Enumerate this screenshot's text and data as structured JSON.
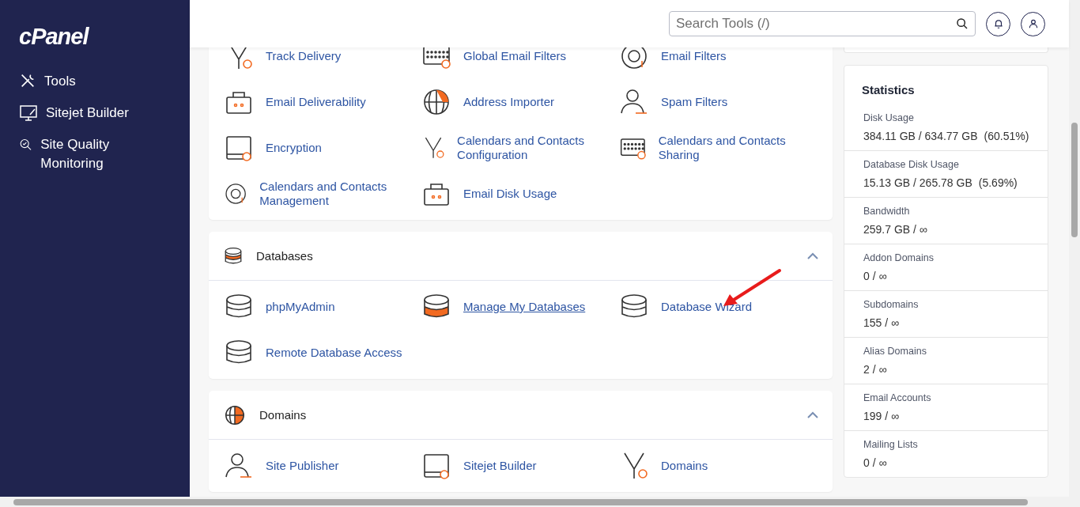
{
  "sidebar": {
    "logo": "cPanel",
    "items": [
      {
        "label": "Tools"
      },
      {
        "label": "Sitejet Builder"
      },
      {
        "label": "Site Quality Monitoring"
      }
    ]
  },
  "search": {
    "placeholder": "Search Tools (/)"
  },
  "sections": [
    {
      "items": [
        {
          "label": "Track Delivery",
          "hovered": false
        },
        {
          "label": "Global Email Filters",
          "hovered": false
        },
        {
          "label": "Email Filters",
          "hovered": false
        },
        {
          "label": "Email Deliverability",
          "hovered": false
        },
        {
          "label": "Address Importer",
          "hovered": false
        },
        {
          "label": "Spam Filters",
          "hovered": false
        },
        {
          "label": "Encryption",
          "hovered": false
        },
        {
          "label": "Calendars and Contacts Configuration",
          "hovered": false
        },
        {
          "label": "Calendars and Contacts Sharing",
          "hovered": false
        },
        {
          "label": "Calendars and Contacts Management",
          "hovered": false
        },
        {
          "label": "Email Disk Usage",
          "hovered": false
        }
      ]
    },
    {
      "title": "Databases",
      "expanded": true,
      "items": [
        {
          "label": "phpMyAdmin",
          "hovered": false
        },
        {
          "label": "Manage My Databases",
          "hovered": true
        },
        {
          "label": "Database Wizard",
          "hovered": false
        },
        {
          "label": "Remote Database Access",
          "hovered": false
        }
      ]
    },
    {
      "title": "Domains",
      "expanded": true,
      "items": [
        {
          "label": "Site Publisher",
          "hovered": false
        },
        {
          "label": "Sitejet Builder",
          "hovered": false
        },
        {
          "label": "Domains",
          "hovered": false
        }
      ]
    }
  ],
  "statistics": {
    "title": "Statistics",
    "rows": [
      {
        "label": "Disk Usage",
        "value": "384.11 GB / 634.77 GB",
        "percent": "(60.51%)"
      },
      {
        "label": "Database Disk Usage",
        "value": "15.13 GB / 265.78 GB",
        "percent": "(5.69%)"
      },
      {
        "label": "Bandwidth",
        "value": "259.7 GB / ∞"
      },
      {
        "label": "Addon Domains",
        "value": "0 / ∞"
      },
      {
        "label": "Subdomains",
        "value": "155 / ∞"
      },
      {
        "label": "Alias Domains",
        "value": "2 / ∞"
      },
      {
        "label": "Email Accounts",
        "value": "199 / ∞"
      },
      {
        "label": "Mailing Lists",
        "value": "0 / ∞"
      }
    ]
  }
}
